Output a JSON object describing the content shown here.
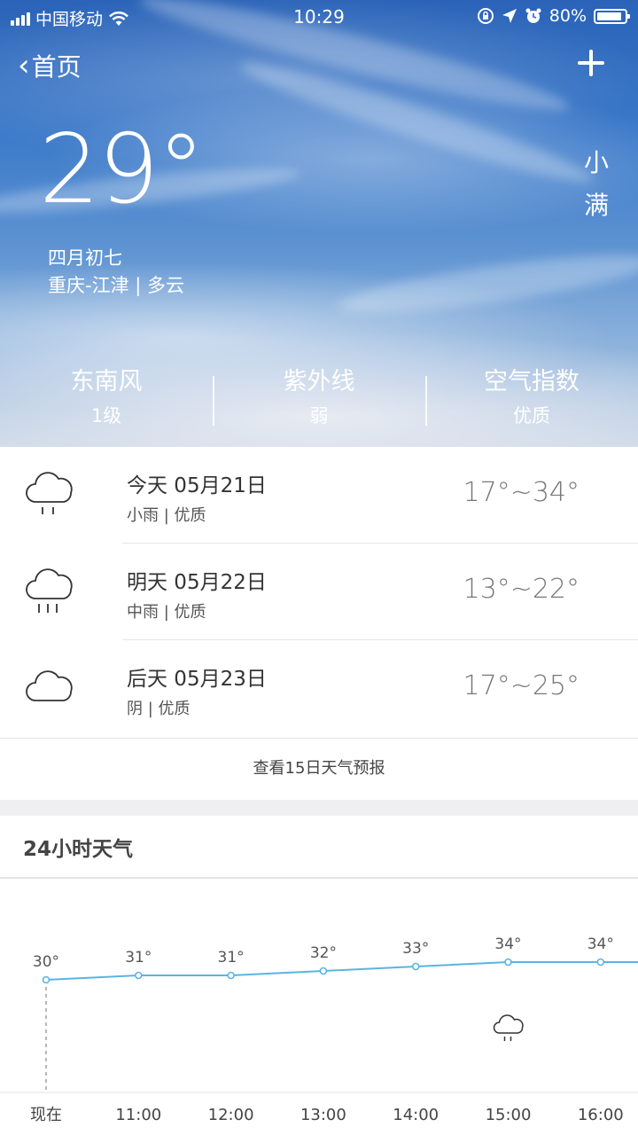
{
  "status_bar": {
    "carrier": "中国移动",
    "time": "10:29",
    "battery": "80%"
  },
  "nav": {
    "back_label": "首页"
  },
  "current": {
    "temperature": "29°",
    "lunar_date": "四月初七",
    "location_weather": "重庆-江津 | 多云",
    "solar_term": "小满"
  },
  "indices": [
    {
      "title": "东南风",
      "value": "1级"
    },
    {
      "title": "紫外线",
      "value": "弱"
    },
    {
      "title": "空气指数",
      "value": "优质"
    }
  ],
  "forecast": [
    {
      "date": "今天 05月21日",
      "desc": "小雨 | 优质",
      "range": "17°~34°",
      "icon": "light-rain-icon"
    },
    {
      "date": "明天 05月22日",
      "desc": "中雨 | 优质",
      "range": "13°~22°",
      "icon": "moderate-rain-icon"
    },
    {
      "date": "后天 05月23日",
      "desc": "阴 | 优质",
      "range": "17°~25°",
      "icon": "cloud-icon"
    }
  ],
  "more_forecast": "查看15日天气预报",
  "hourly": {
    "title": "24小时天气"
  },
  "chart_data": {
    "type": "line",
    "categories": [
      "现在",
      "11:00",
      "12:00",
      "13:00",
      "14:00",
      "15:00",
      "16:00"
    ],
    "series": [
      {
        "values": [
          30,
          31,
          31,
          32,
          33,
          34,
          34
        ]
      }
    ],
    "point_labels": [
      "30°",
      "31°",
      "31°",
      "32°",
      "33°",
      "34°",
      "34°"
    ],
    "icons": [
      {
        "category": "15:00",
        "icon": "rain-cloud-icon"
      }
    ],
    "line_color": "#5bb4e3"
  }
}
